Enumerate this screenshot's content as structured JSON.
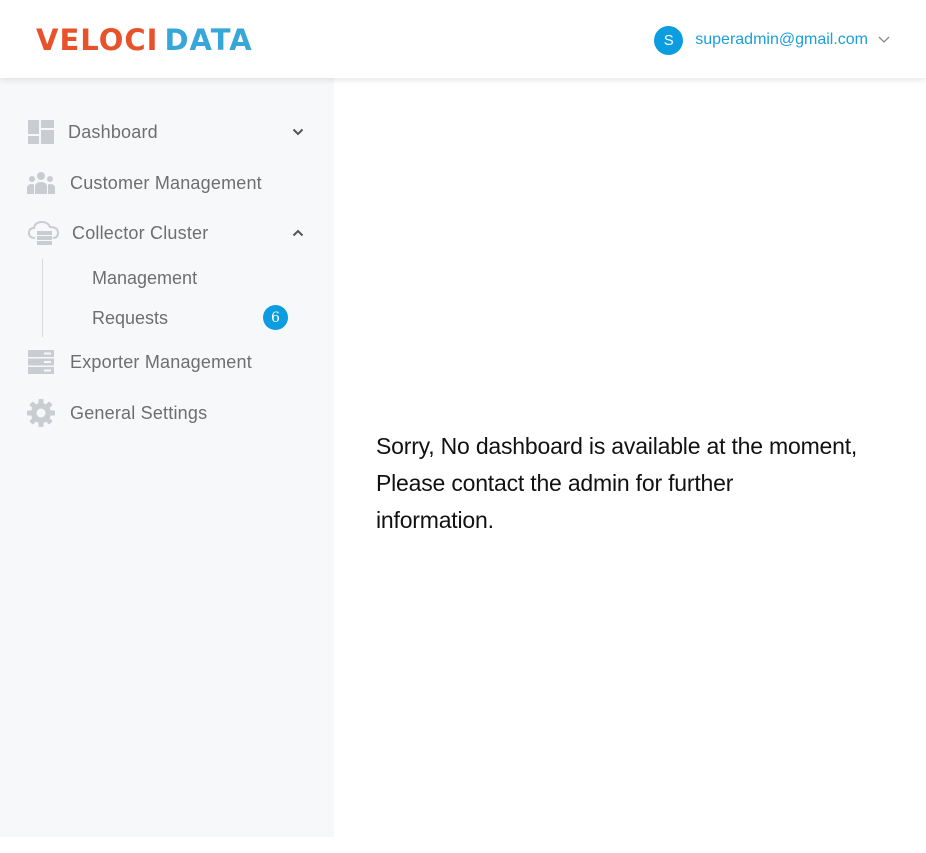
{
  "header": {
    "logo_part1": "VELOCI",
    "logo_part2": "DATA",
    "user_initial": "S",
    "user_email": "superadmin@gmail.com"
  },
  "sidebar": {
    "items": [
      {
        "label": "Dashboard",
        "icon": "dashboard-icon",
        "chevron": "down"
      },
      {
        "label": "Customer Management",
        "icon": "users-icon"
      },
      {
        "label": "Collector Cluster",
        "icon": "cloud-server-icon",
        "chevron": "up"
      },
      {
        "label": "Exporter Management",
        "icon": "server-icon"
      },
      {
        "label": "General Settings",
        "icon": "gear-icon"
      }
    ],
    "sub_items": [
      {
        "label": "Management"
      },
      {
        "label": "Requests",
        "badge": "6"
      }
    ]
  },
  "main": {
    "message_lines": [
      "Sorry, No dashboard is available at the moment,",
      "Please contact the admin for further",
      "information."
    ]
  },
  "colors": {
    "logo_orange": "#e8522a",
    "logo_blue": "#37a7da",
    "accent": "#0c9ce0",
    "sidebar_bg": "#f7f8fa",
    "icon_gray": "#c9cdd2"
  }
}
